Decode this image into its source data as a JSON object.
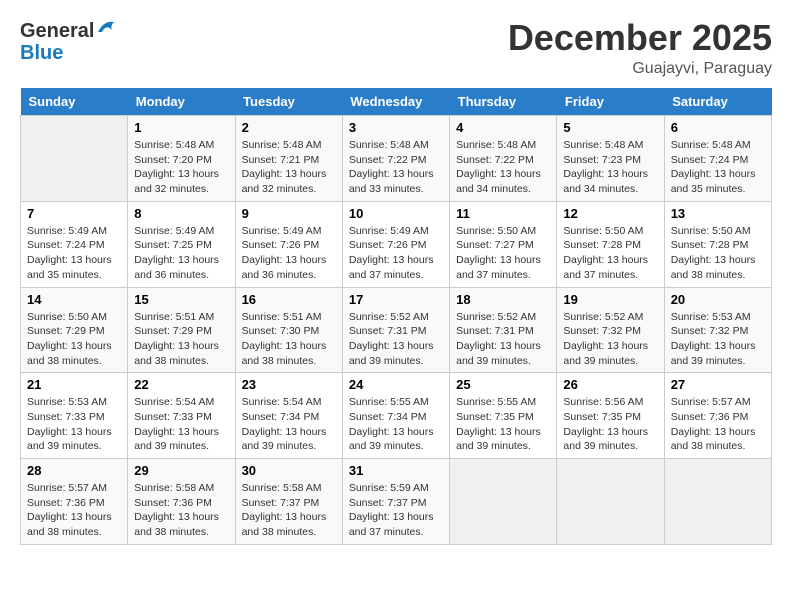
{
  "header": {
    "logo_general": "General",
    "logo_blue": "Blue",
    "month": "December 2025",
    "location": "Guajayvi, Paraguay"
  },
  "days_of_week": [
    "Sunday",
    "Monday",
    "Tuesday",
    "Wednesday",
    "Thursday",
    "Friday",
    "Saturday"
  ],
  "weeks": [
    [
      {
        "day": "",
        "sunrise": "",
        "sunset": "",
        "daylight": ""
      },
      {
        "day": "1",
        "sunrise": "Sunrise: 5:48 AM",
        "sunset": "Sunset: 7:20 PM",
        "daylight": "Daylight: 13 hours and 32 minutes."
      },
      {
        "day": "2",
        "sunrise": "Sunrise: 5:48 AM",
        "sunset": "Sunset: 7:21 PM",
        "daylight": "Daylight: 13 hours and 32 minutes."
      },
      {
        "day": "3",
        "sunrise": "Sunrise: 5:48 AM",
        "sunset": "Sunset: 7:22 PM",
        "daylight": "Daylight: 13 hours and 33 minutes."
      },
      {
        "day": "4",
        "sunrise": "Sunrise: 5:48 AM",
        "sunset": "Sunset: 7:22 PM",
        "daylight": "Daylight: 13 hours and 34 minutes."
      },
      {
        "day": "5",
        "sunrise": "Sunrise: 5:48 AM",
        "sunset": "Sunset: 7:23 PM",
        "daylight": "Daylight: 13 hours and 34 minutes."
      },
      {
        "day": "6",
        "sunrise": "Sunrise: 5:48 AM",
        "sunset": "Sunset: 7:24 PM",
        "daylight": "Daylight: 13 hours and 35 minutes."
      }
    ],
    [
      {
        "day": "7",
        "sunrise": "Sunrise: 5:49 AM",
        "sunset": "Sunset: 7:24 PM",
        "daylight": "Daylight: 13 hours and 35 minutes."
      },
      {
        "day": "8",
        "sunrise": "Sunrise: 5:49 AM",
        "sunset": "Sunset: 7:25 PM",
        "daylight": "Daylight: 13 hours and 36 minutes."
      },
      {
        "day": "9",
        "sunrise": "Sunrise: 5:49 AM",
        "sunset": "Sunset: 7:26 PM",
        "daylight": "Daylight: 13 hours and 36 minutes."
      },
      {
        "day": "10",
        "sunrise": "Sunrise: 5:49 AM",
        "sunset": "Sunset: 7:26 PM",
        "daylight": "Daylight: 13 hours and 37 minutes."
      },
      {
        "day": "11",
        "sunrise": "Sunrise: 5:50 AM",
        "sunset": "Sunset: 7:27 PM",
        "daylight": "Daylight: 13 hours and 37 minutes."
      },
      {
        "day": "12",
        "sunrise": "Sunrise: 5:50 AM",
        "sunset": "Sunset: 7:28 PM",
        "daylight": "Daylight: 13 hours and 37 minutes."
      },
      {
        "day": "13",
        "sunrise": "Sunrise: 5:50 AM",
        "sunset": "Sunset: 7:28 PM",
        "daylight": "Daylight: 13 hours and 38 minutes."
      }
    ],
    [
      {
        "day": "14",
        "sunrise": "Sunrise: 5:50 AM",
        "sunset": "Sunset: 7:29 PM",
        "daylight": "Daylight: 13 hours and 38 minutes."
      },
      {
        "day": "15",
        "sunrise": "Sunrise: 5:51 AM",
        "sunset": "Sunset: 7:29 PM",
        "daylight": "Daylight: 13 hours and 38 minutes."
      },
      {
        "day": "16",
        "sunrise": "Sunrise: 5:51 AM",
        "sunset": "Sunset: 7:30 PM",
        "daylight": "Daylight: 13 hours and 38 minutes."
      },
      {
        "day": "17",
        "sunrise": "Sunrise: 5:52 AM",
        "sunset": "Sunset: 7:31 PM",
        "daylight": "Daylight: 13 hours and 39 minutes."
      },
      {
        "day": "18",
        "sunrise": "Sunrise: 5:52 AM",
        "sunset": "Sunset: 7:31 PM",
        "daylight": "Daylight: 13 hours and 39 minutes."
      },
      {
        "day": "19",
        "sunrise": "Sunrise: 5:52 AM",
        "sunset": "Sunset: 7:32 PM",
        "daylight": "Daylight: 13 hours and 39 minutes."
      },
      {
        "day": "20",
        "sunrise": "Sunrise: 5:53 AM",
        "sunset": "Sunset: 7:32 PM",
        "daylight": "Daylight: 13 hours and 39 minutes."
      }
    ],
    [
      {
        "day": "21",
        "sunrise": "Sunrise: 5:53 AM",
        "sunset": "Sunset: 7:33 PM",
        "daylight": "Daylight: 13 hours and 39 minutes."
      },
      {
        "day": "22",
        "sunrise": "Sunrise: 5:54 AM",
        "sunset": "Sunset: 7:33 PM",
        "daylight": "Daylight: 13 hours and 39 minutes."
      },
      {
        "day": "23",
        "sunrise": "Sunrise: 5:54 AM",
        "sunset": "Sunset: 7:34 PM",
        "daylight": "Daylight: 13 hours and 39 minutes."
      },
      {
        "day": "24",
        "sunrise": "Sunrise: 5:55 AM",
        "sunset": "Sunset: 7:34 PM",
        "daylight": "Daylight: 13 hours and 39 minutes."
      },
      {
        "day": "25",
        "sunrise": "Sunrise: 5:55 AM",
        "sunset": "Sunset: 7:35 PM",
        "daylight": "Daylight: 13 hours and 39 minutes."
      },
      {
        "day": "26",
        "sunrise": "Sunrise: 5:56 AM",
        "sunset": "Sunset: 7:35 PM",
        "daylight": "Daylight: 13 hours and 39 minutes."
      },
      {
        "day": "27",
        "sunrise": "Sunrise: 5:57 AM",
        "sunset": "Sunset: 7:36 PM",
        "daylight": "Daylight: 13 hours and 38 minutes."
      }
    ],
    [
      {
        "day": "28",
        "sunrise": "Sunrise: 5:57 AM",
        "sunset": "Sunset: 7:36 PM",
        "daylight": "Daylight: 13 hours and 38 minutes."
      },
      {
        "day": "29",
        "sunrise": "Sunrise: 5:58 AM",
        "sunset": "Sunset: 7:36 PM",
        "daylight": "Daylight: 13 hours and 38 minutes."
      },
      {
        "day": "30",
        "sunrise": "Sunrise: 5:58 AM",
        "sunset": "Sunset: 7:37 PM",
        "daylight": "Daylight: 13 hours and 38 minutes."
      },
      {
        "day": "31",
        "sunrise": "Sunrise: 5:59 AM",
        "sunset": "Sunset: 7:37 PM",
        "daylight": "Daylight: 13 hours and 37 minutes."
      },
      {
        "day": "",
        "sunrise": "",
        "sunset": "",
        "daylight": ""
      },
      {
        "day": "",
        "sunrise": "",
        "sunset": "",
        "daylight": ""
      },
      {
        "day": "",
        "sunrise": "",
        "sunset": "",
        "daylight": ""
      }
    ]
  ]
}
